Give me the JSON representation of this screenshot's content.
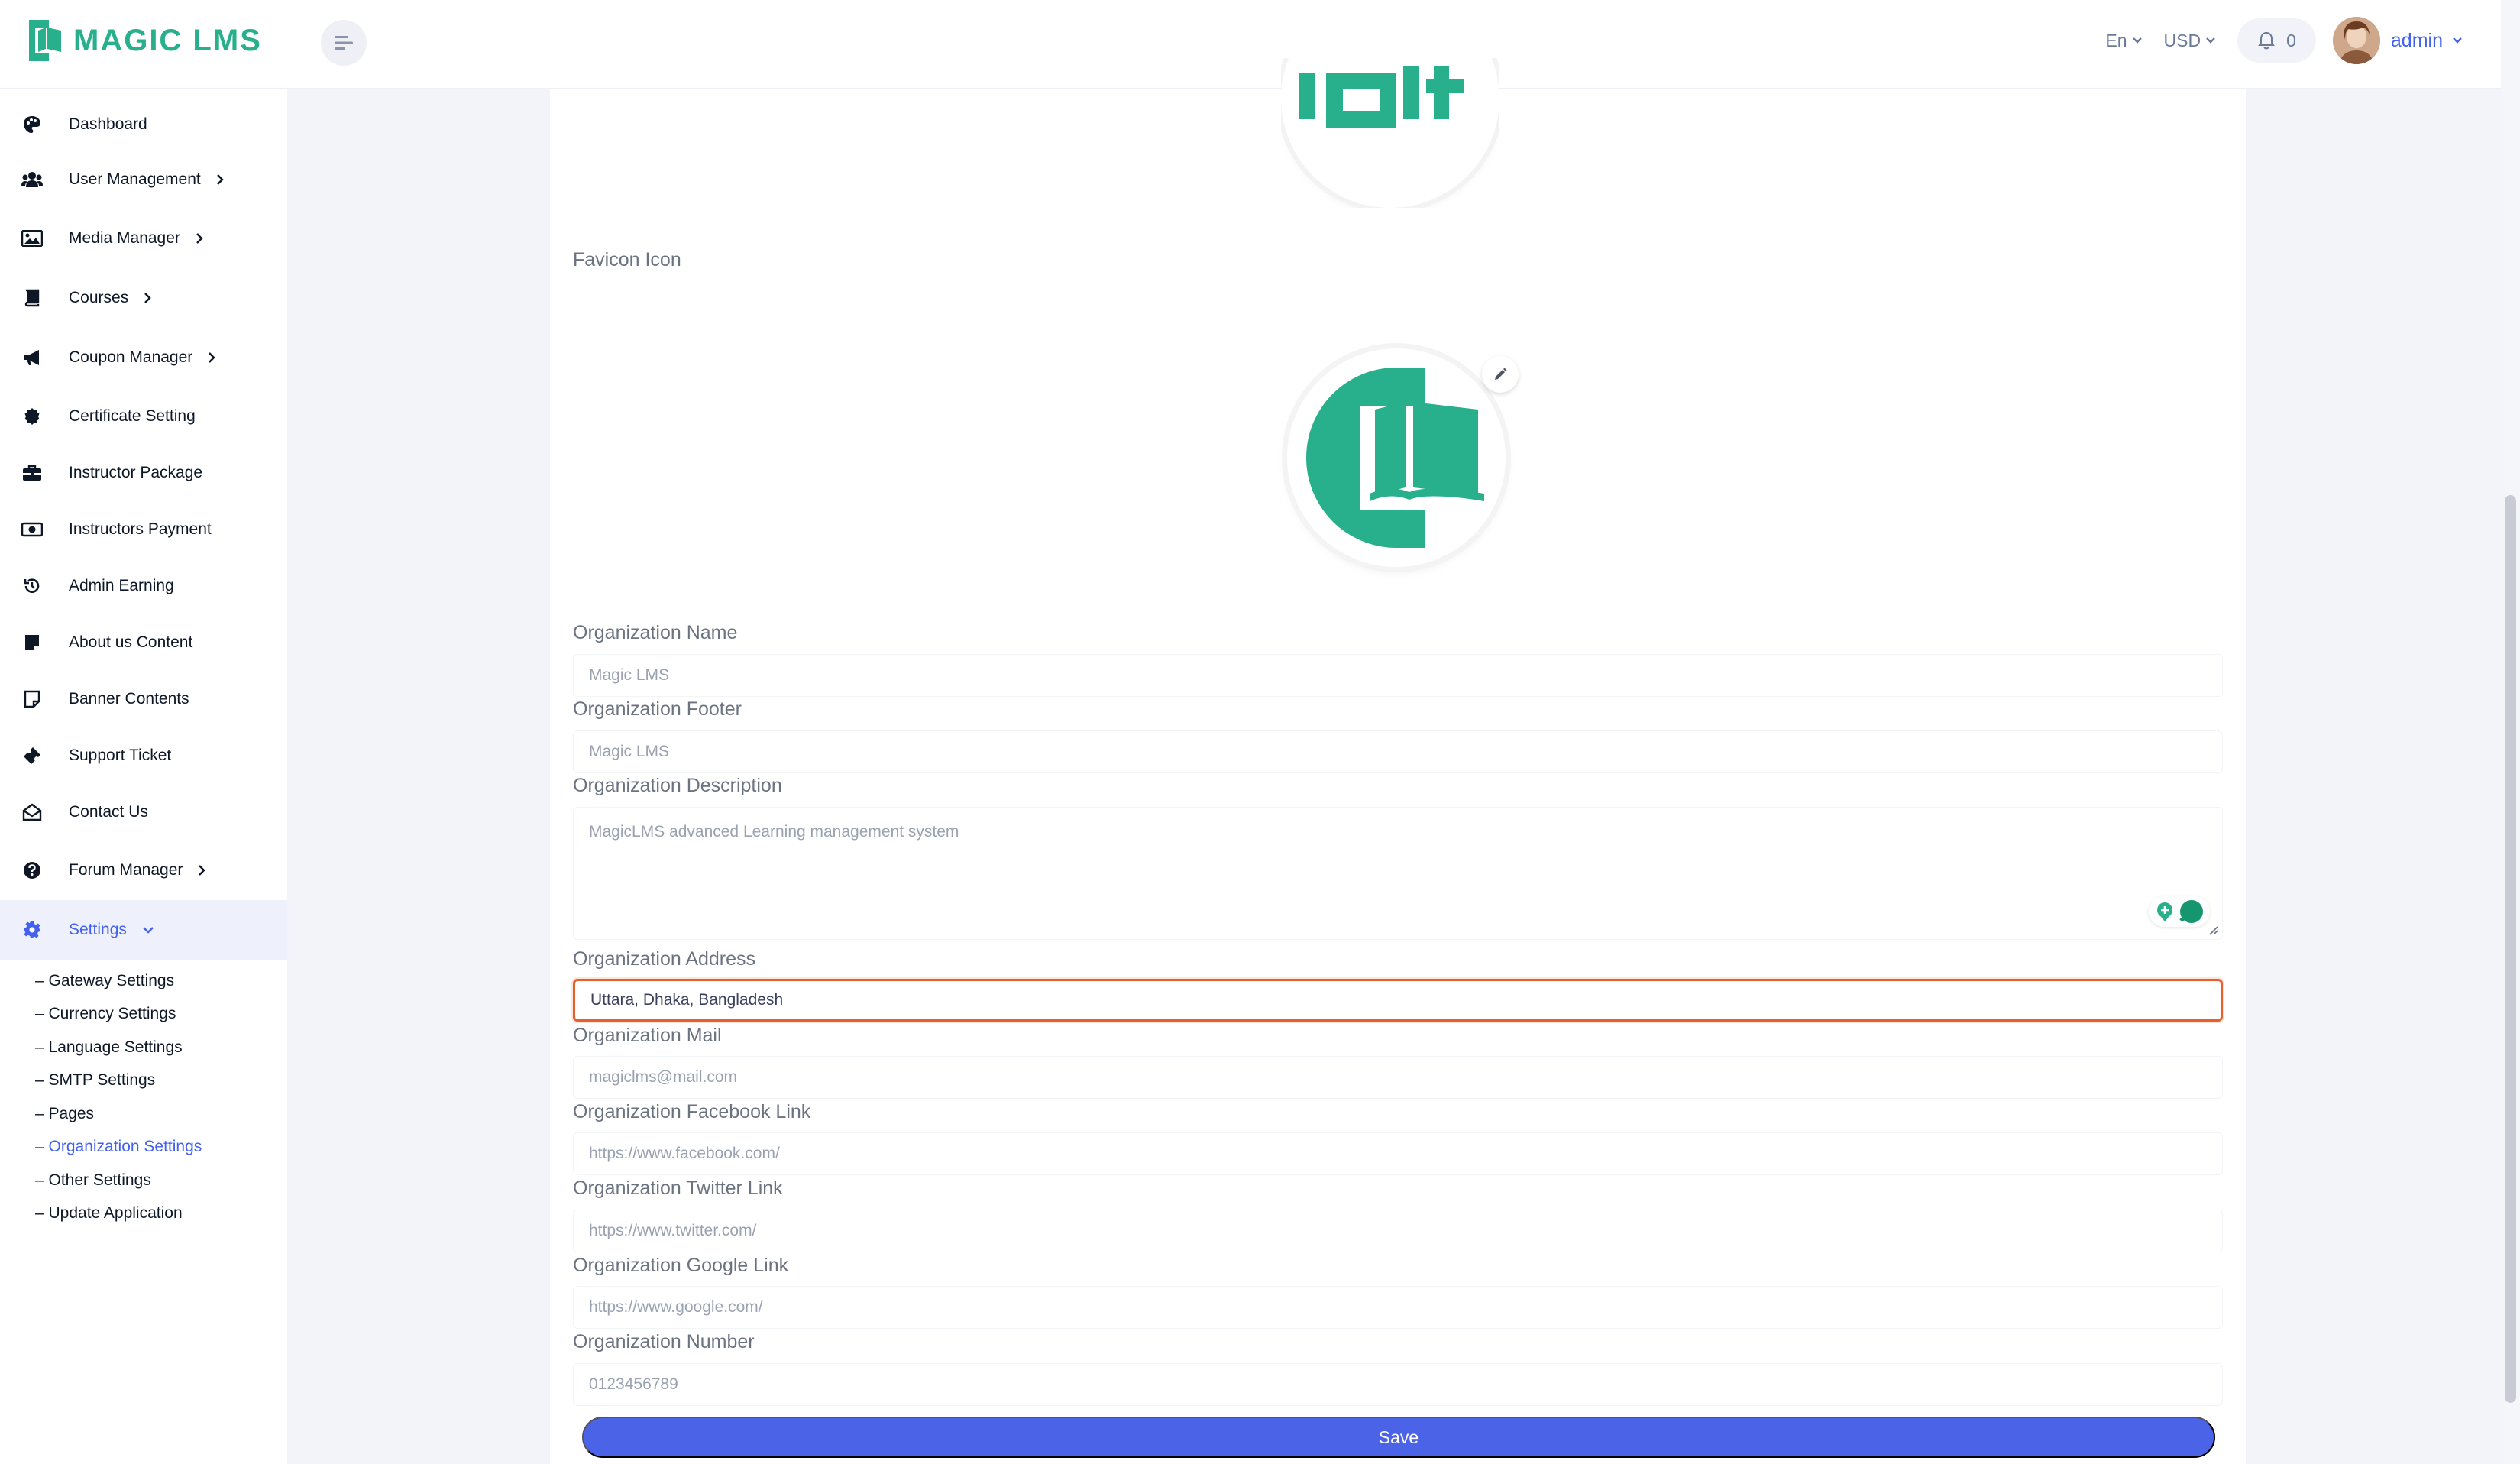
{
  "app": {
    "brand": "MAGIC LMS",
    "brand_color": "#27b08b",
    "accent_color": "#4361ee"
  },
  "header": {
    "language": "En",
    "currency": "USD",
    "notification_count": "0",
    "user_name": "admin"
  },
  "sidebar": {
    "items": [
      {
        "label": "Dashboard",
        "icon": "palette-icon"
      },
      {
        "label": "User Management",
        "icon": "users-icon"
      },
      {
        "label": "Media Manager",
        "icon": "image-icon"
      },
      {
        "label": "Courses",
        "icon": "book-icon"
      },
      {
        "label": "Coupon Manager",
        "icon": "megaphone-icon"
      },
      {
        "label": "Certificate Setting",
        "icon": "certificate-icon"
      },
      {
        "label": "Instructor Package",
        "icon": "briefcase-icon"
      },
      {
        "label": "Instructors Payment",
        "icon": "money-icon"
      },
      {
        "label": "Admin Earning",
        "icon": "history-icon"
      },
      {
        "label": "About us Content",
        "icon": "note-icon"
      },
      {
        "label": "Banner Contents",
        "icon": "sticky-note-icon"
      },
      {
        "label": "Support Ticket",
        "icon": "ticket-icon"
      },
      {
        "label": "Contact Us",
        "icon": "envelope-open-icon"
      },
      {
        "label": "Forum Manager",
        "icon": "question-circle-icon"
      },
      {
        "label": "Settings",
        "icon": "cog-icon"
      }
    ],
    "settings_sub": [
      "– Gateway Settings",
      "– Currency Settings",
      "– Language Settings",
      "– SMTP Settings",
      "– Pages",
      "– Organization Settings",
      "– Other Settings",
      "– Update Application"
    ]
  },
  "form": {
    "favicon_label": "Favicon Icon",
    "org_name_label": "Organization Name",
    "org_name_value": "Magic LMS",
    "org_footer_label": "Organization Footer",
    "org_footer_value": "Magic LMS",
    "org_description_label": "Organization Description",
    "org_description_value": "MagicLMS advanced Learning management system",
    "org_address_label": "Organization Address",
    "org_address_value": "Uttara, Dhaka, Bangladesh",
    "org_mail_label": "Organization Mail",
    "org_mail_value": "magiclms@mail.com",
    "org_facebook_label": "Organization Facebook Link",
    "org_facebook_value": "https://www.facebook.com/",
    "org_twitter_label": "Organization Twitter Link",
    "org_twitter_value": "https://www.twitter.com/",
    "org_google_label": "Organization Google Link",
    "org_google_value": "https://www.google.com/",
    "org_number_label": "Organization Number",
    "org_number_value": "0123456789",
    "save_label": "Save"
  }
}
